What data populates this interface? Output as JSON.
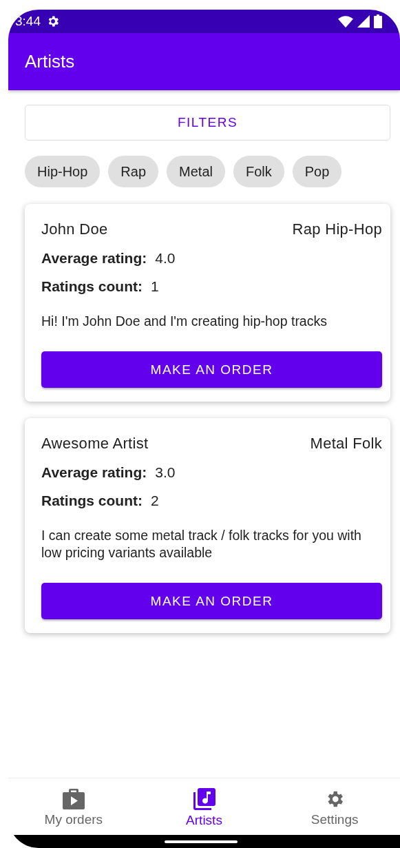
{
  "status_bar": {
    "time": "3:44"
  },
  "app_bar": {
    "title": "Artists"
  },
  "filters_button": "FILTERS",
  "chips": [
    {
      "label": "Hip-Hop"
    },
    {
      "label": "Rap"
    },
    {
      "label": "Metal"
    },
    {
      "label": "Folk"
    },
    {
      "label": "Pop"
    }
  ],
  "artists": [
    {
      "name": "John Doe",
      "genres": "Rap Hip-Hop",
      "rating_label": "Average rating:",
      "rating": "4.0",
      "count_label": "Ratings count:",
      "count": "1",
      "description": "Hi! I'm John Doe and I'm creating hip-hop tracks",
      "button": "MAKE AN ORDER"
    },
    {
      "name": "Awesome Artist",
      "genres": "Metal Folk",
      "rating_label": "Average rating:",
      "rating": "3.0",
      "count_label": "Ratings count:",
      "count": "2",
      "description": "I can create some metal track / folk tracks for you with low pricing variants available",
      "button": "MAKE AN ORDER"
    }
  ],
  "bottom_nav": [
    {
      "label": "My orders",
      "kind": "orders",
      "selected": false
    },
    {
      "label": "Artists",
      "kind": "artists",
      "selected": true
    },
    {
      "label": "Settings",
      "kind": "settings",
      "selected": false
    }
  ]
}
